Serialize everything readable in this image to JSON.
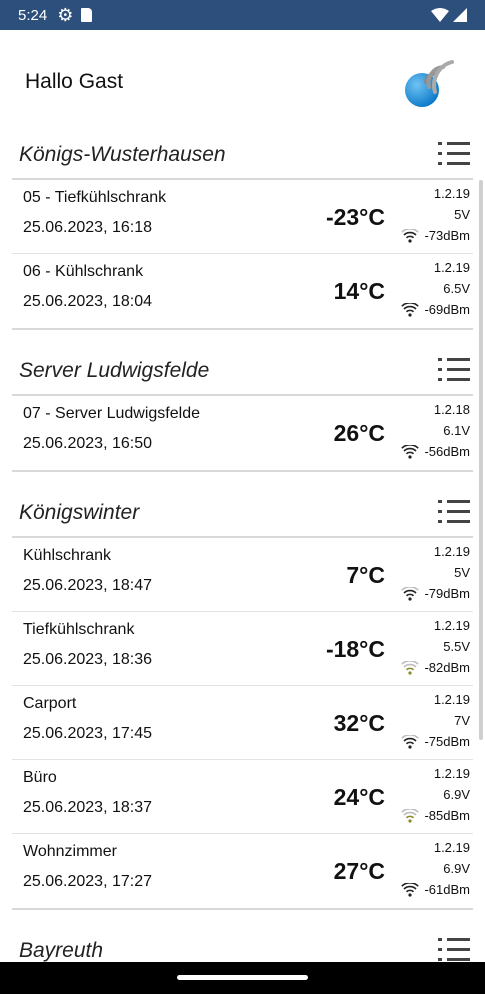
{
  "status": {
    "time": "5:24"
  },
  "header": {
    "greeting": "Hallo Gast"
  },
  "colors": {
    "statusbar": "#2d4f7c",
    "wifi_dark": "#222222",
    "wifi_weak": "#8a8a2a"
  },
  "sections": [
    {
      "title": "Königs-Wusterhausen",
      "devices": [
        {
          "name": "05 - Tiefkühlschrank",
          "datetime": "25.06.2023, 16:18",
          "temperature": "-23°C",
          "firmware": "1.2.19",
          "voltage": "5V",
          "signal": "-73dBm",
          "signal_level": "medium"
        },
        {
          "name": "06 - Kühlschrank",
          "datetime": "25.06.2023, 18:04",
          "temperature": "14°C",
          "firmware": "1.2.19",
          "voltage": "6.5V",
          "signal": "-69dBm",
          "signal_level": "good"
        }
      ]
    },
    {
      "title": "Server Ludwigsfelde",
      "devices": [
        {
          "name": "07 - Server Ludwigsfelde",
          "datetime": "25.06.2023, 16:50",
          "temperature": "26°C",
          "firmware": "1.2.18",
          "voltage": "6.1V",
          "signal": "-56dBm",
          "signal_level": "good"
        }
      ]
    },
    {
      "title": "Königswinter",
      "devices": [
        {
          "name": "Kühlschrank",
          "datetime": "25.06.2023, 18:47",
          "temperature": "7°C",
          "firmware": "1.2.19",
          "voltage": "5V",
          "signal": "-79dBm",
          "signal_level": "medium"
        },
        {
          "name": "Tiefkühlschrank",
          "datetime": "25.06.2023, 18:36",
          "temperature": "-18°C",
          "firmware": "1.2.19",
          "voltage": "5.5V",
          "signal": "-82dBm",
          "signal_level": "weak"
        },
        {
          "name": "Carport",
          "datetime": "25.06.2023, 17:45",
          "temperature": "32°C",
          "firmware": "1.2.19",
          "voltage": "7V",
          "signal": "-75dBm",
          "signal_level": "medium"
        },
        {
          "name": "Büro",
          "datetime": "25.06.2023, 18:37",
          "temperature": "24°C",
          "firmware": "1.2.19",
          "voltage": "6.9V",
          "signal": "-85dBm",
          "signal_level": "weak"
        },
        {
          "name": "Wohnzimmer",
          "datetime": "25.06.2023, 17:27",
          "temperature": "27°C",
          "firmware": "1.2.19",
          "voltage": "6.9V",
          "signal": "-61dBm",
          "signal_level": "good"
        }
      ]
    },
    {
      "title": "Bayreuth",
      "devices": []
    }
  ]
}
